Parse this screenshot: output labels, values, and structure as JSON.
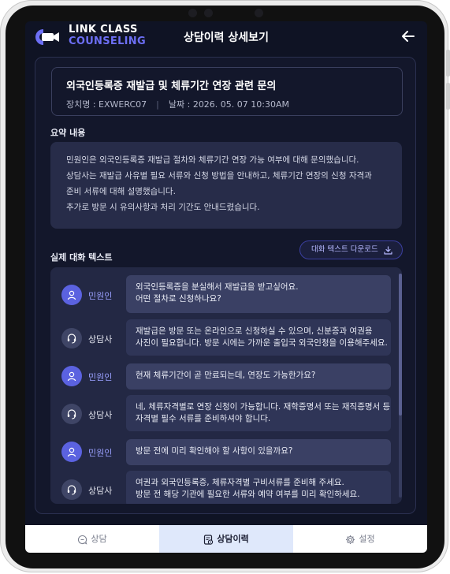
{
  "app": {
    "brand_line1": "LINK CLASS",
    "brand_line2": "COUNSELING",
    "title": "상담이력 상세보기"
  },
  "case": {
    "title": "외국인등록증 재발급 및 체류기간 연장 관련 문의",
    "device": "장치명 : EXWERC07",
    "date": "날짜 : 2026. 05. 07  10:30AM"
  },
  "summary": {
    "label": "요약 내용",
    "lines": [
      "민원인은 외국인등록증 재발급 절차와 체류기간 연장 가능 여부에 대해 문의했습니다.",
      "상담사는 재발급 사유별 필요 서류와 신청 방법을 안내하고, 체류기간 연장의 신청 자격과",
      "준비 서류에 대해 설명했습니다.",
      "추가로 방문 시 유의사항과 처리 기간도 안내드렸습니다."
    ]
  },
  "transcript": {
    "label": "실제 대화 텍스트",
    "download_label": "대화 텍스트 다운로드",
    "messages": [
      {
        "speaker": "민원인",
        "lines": [
          "외국인등록증을 분실해서 재발급을 받고싶어요.",
          "어떤 절차로 신청하나요?"
        ]
      },
      {
        "speaker": "상담사",
        "lines": [
          "재발급은 방문 또는 온라인으로 신청하실 수 있으며, 신분증과 여권용",
          "사진이 필요합니다. 방문 시에는 가까운 출입국 외국인청을 이용해주세요."
        ]
      },
      {
        "speaker": "민원인",
        "lines": [
          "현재 체류기간이 곧 만료되는데, 연장도 가능한가요?"
        ]
      },
      {
        "speaker": "상담사",
        "lines": [
          "네, 체류자격별로 연장 신청이 가능합니다. 재학증명서 또는 재직증명서 등",
          "자격별 필수 서류를 준비하셔야 합니다."
        ]
      },
      {
        "speaker": "민원인",
        "lines": [
          "방문 전에 미리 확인해야 할 사항이 있을까요?"
        ]
      },
      {
        "speaker": "상담사",
        "lines": [
          "여권과 외국인등록증, 체류자격별 구비서류를 준비해 주세요.",
          "방문 전 해당 기관에 필요한 서류와 예약 여부를 미리 확인하세요."
        ]
      }
    ]
  },
  "tabs": [
    {
      "label": "상담",
      "icon": "chat-icon",
      "active": false
    },
    {
      "label": "상담이력",
      "icon": "history-icon",
      "active": true
    },
    {
      "label": "설정",
      "icon": "gear-icon",
      "active": false
    }
  ],
  "colors": {
    "accent": "#6d6ff5",
    "background": "#0f1324",
    "customer_avatar": "#5b62e0"
  }
}
